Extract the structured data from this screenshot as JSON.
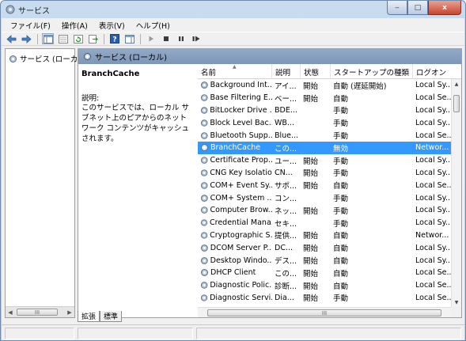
{
  "window": {
    "title": "サービス",
    "controls": {
      "minimize": "‒",
      "maximize": "□",
      "close": "x"
    }
  },
  "menu": {
    "file": "ファイル(F)",
    "action": "操作(A)",
    "view": "表示(V)",
    "help": "ヘルプ(H)"
  },
  "tree": {
    "root_label": "サービス (ローカ",
    "scroll_grip": "III"
  },
  "panel": {
    "header": "サービス (ローカル)"
  },
  "detail": {
    "service_title": "BranchCache",
    "label": "説明:",
    "text": "このサービスでは、ローカル サブネット上のピアからのネットワーク コンテンツがキャッシュされます。"
  },
  "list": {
    "columns": {
      "name": "名前",
      "description": "説明",
      "status": "状態",
      "startup": "スタートアップの種類",
      "logon": "ログオン"
    },
    "rows": [
      {
        "name": "Background Int...",
        "description": "アイ...",
        "status": "開始",
        "startup": "自動 (遅延開始)",
        "logon": "Local Sy..."
      },
      {
        "name": "Base Filtering E...",
        "description": "ベー...",
        "status": "開始",
        "startup": "自動",
        "logon": "Local Se..."
      },
      {
        "name": "BitLocker Drive ...",
        "description": "BDE...",
        "status": "",
        "startup": "手動",
        "logon": "Local Sy..."
      },
      {
        "name": "Block Level Bac...",
        "description": "WB...",
        "status": "",
        "startup": "手動",
        "logon": "Local Sy..."
      },
      {
        "name": "Bluetooth Supp...",
        "description": "Blue...",
        "status": "",
        "startup": "手動",
        "logon": "Local Se..."
      },
      {
        "name": "BranchCache",
        "description": "この...",
        "status": "",
        "startup": "無効",
        "logon": "Networ...",
        "selected": true
      },
      {
        "name": "Certificate Prop...",
        "description": "ユー...",
        "status": "開始",
        "startup": "手動",
        "logon": "Local Sy..."
      },
      {
        "name": "CNG Key Isolation",
        "description": "CN...",
        "status": "開始",
        "startup": "手動",
        "logon": "Local Sy..."
      },
      {
        "name": "COM+ Event Sy...",
        "description": "サポ...",
        "status": "開始",
        "startup": "自動",
        "logon": "Local Se..."
      },
      {
        "name": "COM+ System ...",
        "description": "コン...",
        "status": "",
        "startup": "手動",
        "logon": "Local Sy..."
      },
      {
        "name": "Computer Brow...",
        "description": "ネッ...",
        "status": "開始",
        "startup": "手動",
        "logon": "Local Sy..."
      },
      {
        "name": "Credential Mana...",
        "description": "セキ...",
        "status": "",
        "startup": "手動",
        "logon": "Local Sy..."
      },
      {
        "name": "Cryptographic S...",
        "description": "提供...",
        "status": "開始",
        "startup": "自動",
        "logon": "Networ..."
      },
      {
        "name": "DCOM Server P...",
        "description": "DC...",
        "status": "開始",
        "startup": "自動",
        "logon": "Local Sy..."
      },
      {
        "name": "Desktop Windo...",
        "description": "デス...",
        "status": "開始",
        "startup": "自動",
        "logon": "Local Sy..."
      },
      {
        "name": "DHCP Client",
        "description": "この...",
        "status": "開始",
        "startup": "自動",
        "logon": "Local Se..."
      },
      {
        "name": "Diagnostic Polic...",
        "description": "診断...",
        "status": "開始",
        "startup": "自動",
        "logon": "Local Se..."
      },
      {
        "name": "Diagnostic Servi...",
        "description": "Dia...",
        "status": "開始",
        "startup": "手動",
        "logon": "Local Se..."
      }
    ],
    "hscroll_grip": "III"
  },
  "tabs": {
    "extended": "拡張",
    "standard": "標準"
  },
  "icons": {
    "back": "back-arrow-icon",
    "forward": "forward-arrow-icon",
    "service": "gear-icon"
  },
  "colors": {
    "selection": "#3399ff",
    "header": "#8aa2c2",
    "close": "#c8452f"
  }
}
